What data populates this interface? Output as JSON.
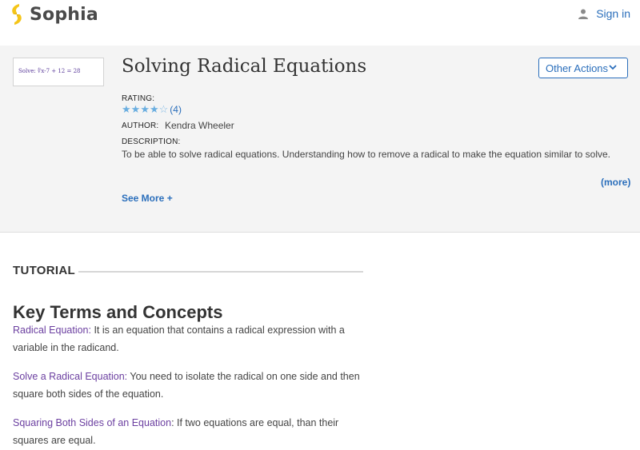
{
  "header": {
    "brand": "Sophia",
    "signin_label": "Sign in",
    "brand_color": "#f5c518",
    "accent_color": "#2a6ebb"
  },
  "lesson": {
    "thumbnail_text": "Solve: ∜x-7 + 12 = 28",
    "title": "Solving Radical Equations",
    "other_actions_label": "Other Actions",
    "rating_label": "RATING:",
    "rating_stars": 4,
    "rating_count": "(4)",
    "author_label": "AUTHOR:",
    "author": "Kendra Wheeler",
    "description_label": "DESCRIPTION:",
    "description": "To be able to solve radical equations. Understanding how to remove a radical to make the equation similar to solve.",
    "more_label": "(more)",
    "see_more_label": "See More +"
  },
  "tutorial": {
    "heading": "TUTORIAL",
    "section_title": "Key Terms and Concepts",
    "terms": [
      {
        "name": "Radical Equation:",
        "text": " It is an equation that contains a radical expression with a variable in the radicand."
      },
      {
        "name": "Solve a Radical Equation:",
        "text": " You need to isolate the radical on one side and then square both sides of the equation."
      },
      {
        "name": "Squaring Both Sides of an Equation",
        "text": ": If two equations are equal, than their squares are equal."
      }
    ]
  }
}
